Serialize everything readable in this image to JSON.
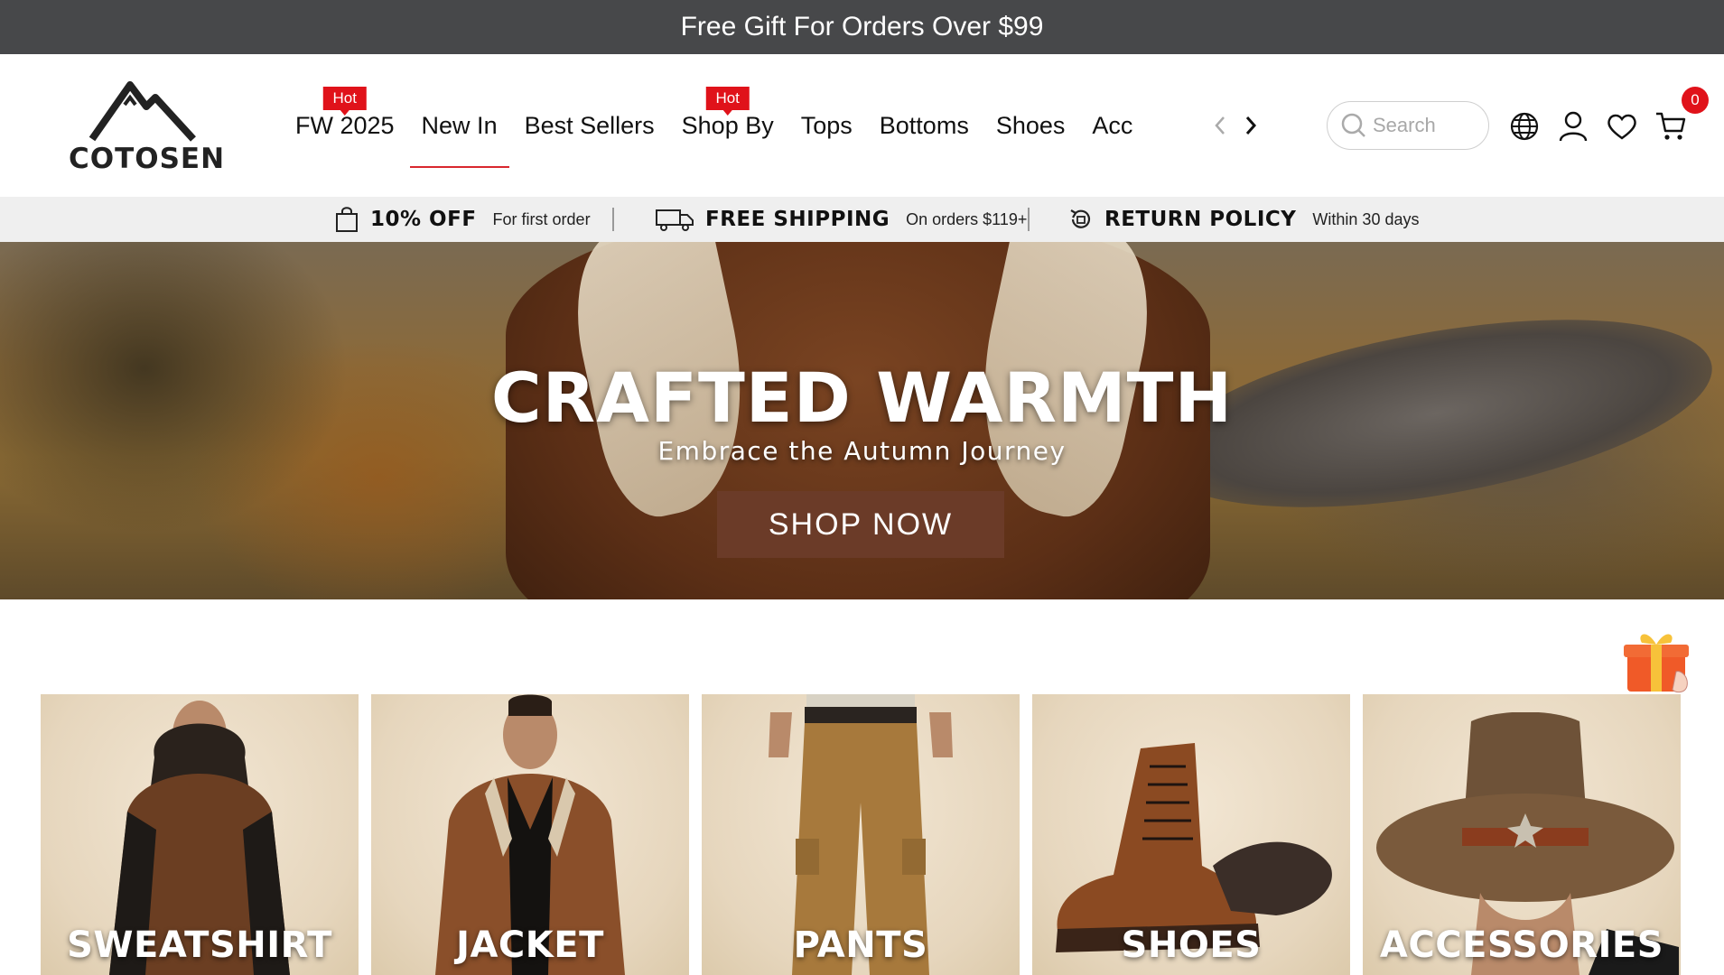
{
  "announcement": {
    "text": "Free Gift For Orders Over $99"
  },
  "brand": {
    "name": "COTOSEN"
  },
  "nav": {
    "items": [
      {
        "label": "FW 2025",
        "badge": "Hot"
      },
      {
        "label": "New In",
        "active": true
      },
      {
        "label": "Best Sellers"
      },
      {
        "label": "Shop By",
        "badge": "Hot"
      },
      {
        "label": "Tops"
      },
      {
        "label": "Bottoms"
      },
      {
        "label": "Shoes"
      },
      {
        "label": "Acc"
      }
    ]
  },
  "search": {
    "placeholder": "Search"
  },
  "header_icons": [
    "globe-icon",
    "user-icon",
    "heart-icon",
    "cart-icon"
  ],
  "cart": {
    "count": "0"
  },
  "benefits": [
    {
      "title": "10% OFF",
      "subtitle": "For first order",
      "icon": "shopping-bag-icon"
    },
    {
      "title": "FREE SHIPPING",
      "subtitle": "On orders $119+",
      "icon": "truck-icon"
    },
    {
      "title": "RETURN POLICY",
      "subtitle": "Within 30 days",
      "icon": "return-icon"
    }
  ],
  "hero": {
    "title": "CRAFTED WARMTH",
    "subtitle": "Embrace the Autumn Journey",
    "cta": "SHOP NOW"
  },
  "categories": [
    {
      "label": "SWEATSHIRT"
    },
    {
      "label": "JACKET"
    },
    {
      "label": "PANTS"
    },
    {
      "label": "SHOES"
    },
    {
      "label": "ACCESSORIES"
    }
  ],
  "colors": {
    "announcement_bg": "#47484a",
    "hot_badge": "#e0121a",
    "active_underline": "#d9272e",
    "cta_bg": "#6b3b28",
    "benefits_bg": "#efefef"
  }
}
